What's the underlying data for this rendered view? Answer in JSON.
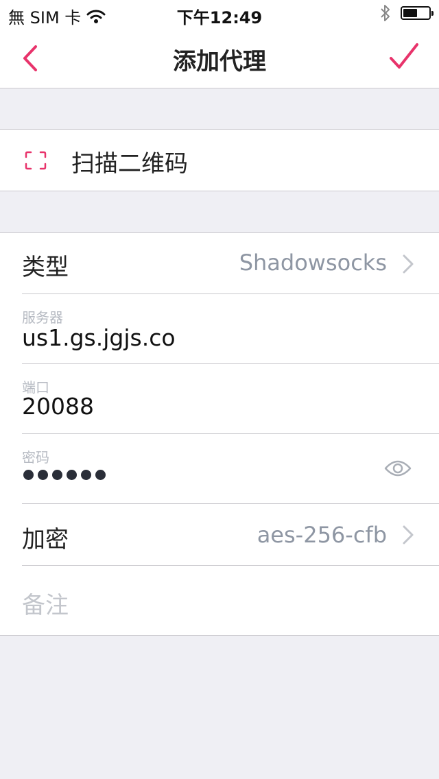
{
  "status_bar": {
    "carrier": "無 SIM 卡",
    "time": "下午12:49",
    "battery_level": 0.55
  },
  "nav": {
    "title": "添加代理"
  },
  "scan": {
    "label": "扫描二维码"
  },
  "form": {
    "type": {
      "label": "类型",
      "value": "Shadowsocks"
    },
    "server": {
      "label": "服务器",
      "value": "us1.gs.jgjs.co"
    },
    "port": {
      "label": "端口",
      "value": "20088"
    },
    "password": {
      "label": "密码",
      "mask_length": 6
    },
    "encryption": {
      "label": "加密",
      "value": "aes-256-cfb"
    },
    "note": {
      "placeholder": "备注"
    }
  },
  "colors": {
    "accent": "#e8336b",
    "background": "#efeff4",
    "separator": "#c8c7cc",
    "secondary_text": "#8e96a3"
  }
}
